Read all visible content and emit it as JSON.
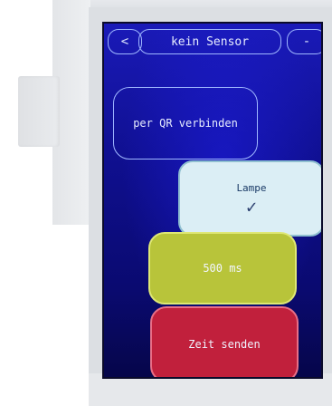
{
  "screen": {
    "header": {
      "back_label": "<",
      "title": "kein Sensor",
      "minus_label": "-"
    },
    "buttons": {
      "qr_label": "per QR verbinden",
      "lamp_label": "Lampe",
      "lamp_check": "✓",
      "interval_label": "500 ms",
      "send_label": "Zeit senden"
    },
    "colors": {
      "screen_bg": "#1212a0",
      "lamp_bg": "#dbeef5",
      "interval_bg": "#b8c43a",
      "send_bg": "#c1203c"
    }
  }
}
